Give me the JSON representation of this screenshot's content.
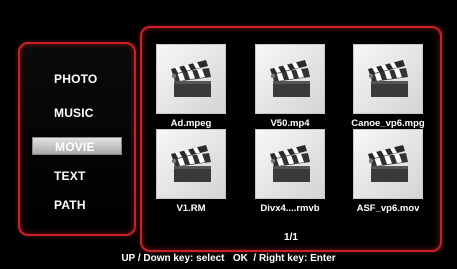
{
  "menu": {
    "items": [
      {
        "label": "PHOTO"
      },
      {
        "label": "MUSIC"
      },
      {
        "label": "MOVIE"
      },
      {
        "label": "TEXT"
      },
      {
        "label": "PATH"
      }
    ],
    "selected": "MOVIE"
  },
  "browser": {
    "files": [
      {
        "name": "Ad.mpeg",
        "icon": "clapperboard-icon"
      },
      {
        "name": "V50.mp4",
        "icon": "clapperboard-icon"
      },
      {
        "name": "Canoe_vp6.mpg",
        "icon": "clapperboard-icon"
      },
      {
        "name": "V1.RM",
        "icon": "clapperboard-icon"
      },
      {
        "name": "Divx4....rmvb",
        "icon": "clapperboard-icon"
      },
      {
        "name": "ASF_vp6.mov",
        "icon": "clapperboard-icon"
      }
    ],
    "page": "1/1"
  },
  "footer": {
    "hint": "UP / Down key: select   OK  / Right key: Enter"
  },
  "colors": {
    "accent_border": "#c8202a",
    "background": "#000000",
    "selected_bg": "#b8b8b8"
  }
}
